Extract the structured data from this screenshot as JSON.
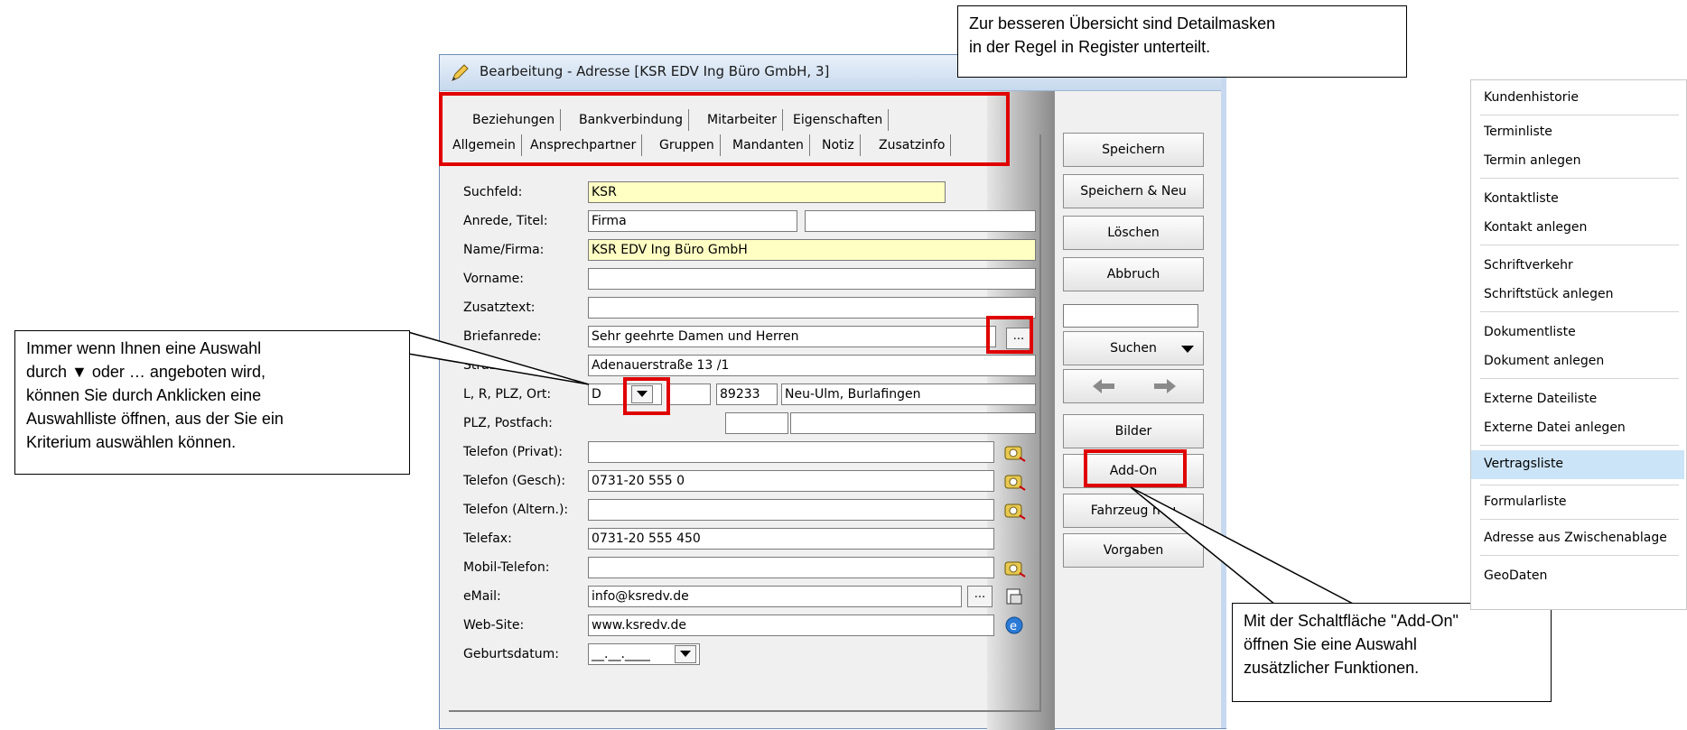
{
  "window": {
    "title": "Bearbeitung - Adresse [KSR EDV Ing Büro GmbH, 3]",
    "tabs_row1": [
      "Beziehungen",
      "Bankverbindung",
      "Mitarbeiter",
      "Eigenschaften"
    ],
    "tabs_row2": [
      "Allgemein",
      "Ansprechpartner",
      "Gruppen",
      "Mandanten",
      "Notiz",
      "Zusatzinfo"
    ]
  },
  "form": {
    "suchfeld": {
      "label": "Suchfeld:",
      "value": "KSR"
    },
    "anrede": {
      "label": "Anrede, Titel:",
      "value": "Firma",
      "titel": ""
    },
    "name": {
      "label": "Name/Firma:",
      "value": "KSR EDV Ing Büro GmbH"
    },
    "vorname": {
      "label": "Vorname:",
      "value": ""
    },
    "zusatztext": {
      "label": "Zusatztext:",
      "value": ""
    },
    "briefanrede": {
      "label": "Briefanrede:",
      "value": "Sehr geehrte Damen und Herren"
    },
    "strasse": {
      "label": "Straße:",
      "value": "Adenauerstraße 13 /1"
    },
    "ort": {
      "label": "L, R, PLZ, Ort:",
      "land": "D",
      "region": "",
      "plz": "89233",
      "ort": "Neu-Ulm, Burlafingen"
    },
    "postfach": {
      "label": "PLZ, Postfach:",
      "plz": "",
      "postfach": ""
    },
    "tel_privat": {
      "label": "Telefon (Privat):",
      "value": ""
    },
    "tel_gesch": {
      "label": "Telefon (Gesch):",
      "value": "0731-20 555 0"
    },
    "tel_altern": {
      "label": "Telefon (Altern.):",
      "value": ""
    },
    "telefax": {
      "label": "Telefax:",
      "value": "0731-20 555 450"
    },
    "mobil": {
      "label": "Mobil-Telefon:",
      "value": ""
    },
    "email": {
      "label": "eMail:",
      "value": "info@ksredv.de"
    },
    "website": {
      "label": "Web-Site:",
      "value": "www.ksredv.de"
    },
    "geburtsdatum": {
      "label": "Geburtsdatum:",
      "value": "__.__.____"
    },
    "ellipsis": "..."
  },
  "buttons": {
    "speichern": "Speichern",
    "speichern_neu": "Speichern & Neu",
    "loeschen": "Löschen",
    "abbruch": "Abbruch",
    "suchen": "Suchen",
    "bilder": "Bilder",
    "addon": "Add-On",
    "fahrzeug": "Fahrzeug neu",
    "vorgaben": "Vorgaben"
  },
  "menu": {
    "items": [
      "Kundenhistorie",
      "Terminliste",
      "Termin anlegen",
      "Kontaktliste",
      "Kontakt anlegen",
      "Schriftverkehr",
      "Schriftstück anlegen",
      "Dokumentliste",
      "Dokument anlegen",
      "Externe Dateiliste",
      "Externe Datei anlegen",
      "Vertragsliste",
      "Formularliste",
      "Adresse aus Zwischenablage",
      "GeoDaten"
    ],
    "highlighted": "Vertragsliste",
    "highlight_color": "#cce4f7"
  },
  "callouts": {
    "top": [
      "Zur besseren Übersicht sind Detailmasken",
      "in der Regel in Register unterteilt."
    ],
    "left": [
      "Immer wenn Ihnen eine Auswahl",
      "durch ▼ oder … angeboten wird,",
      "können Sie durch Anklicken eine",
      "Auswahlliste öffnen, aus der Sie ein",
      "Kriterium auswählen können."
    ],
    "bottom": [
      "Mit der Schaltfläche \"Add-On\"",
      "öffnen Sie eine Auswahl",
      "zusätzlicher Funktionen."
    ]
  },
  "colors": {
    "highlight_red": "#e00000",
    "field_yellow": "#ffffc4"
  }
}
